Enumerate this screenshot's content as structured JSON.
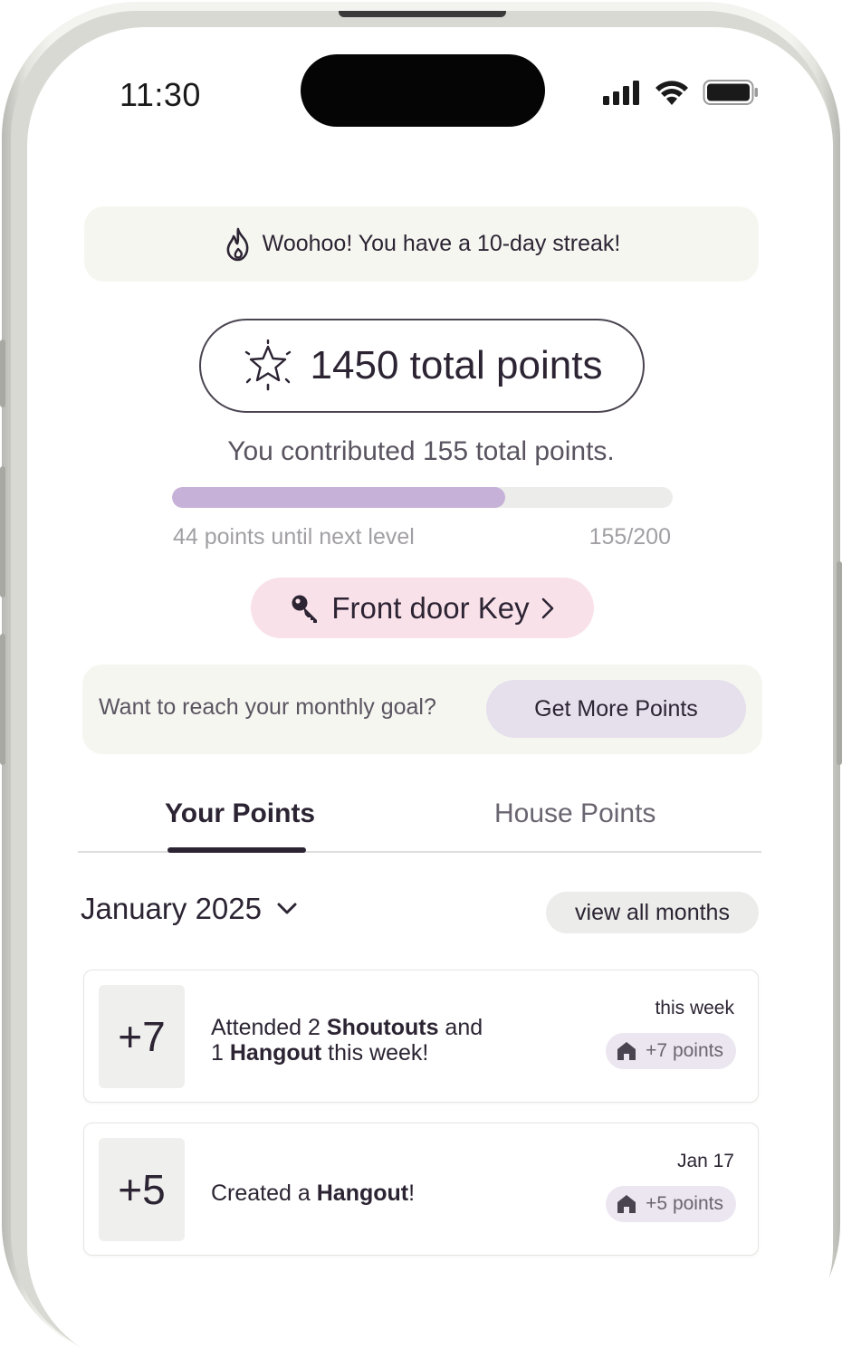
{
  "status_bar": {
    "time": "11:30"
  },
  "streak": {
    "icon": "flame-icon",
    "text": "Woohoo! You have a 10-day streak!"
  },
  "total_points": {
    "icon": "star-icon",
    "label": "1450 total points"
  },
  "contribution": {
    "text": "You contributed 155 total points.",
    "progress_fraction": 0.665,
    "until_next_level": "44 points until next level",
    "ratio": "155/200",
    "fill_color": "#c6b1d8"
  },
  "reward": {
    "icon": "key-icon",
    "label": "Front door Key"
  },
  "goal": {
    "text": "Want to reach your monthly goal?",
    "button": "Get More Points"
  },
  "tabs": [
    {
      "label": "Your Points",
      "active": true
    },
    {
      "label": "House Points",
      "active": false
    }
  ],
  "month_filter": {
    "selected": "January 2025",
    "view_all": "view all months"
  },
  "entries": [
    {
      "amount": "+7",
      "line1": [
        {
          "t": "Attended 2 ",
          "b": false
        },
        {
          "t": "Shoutouts",
          "b": true
        },
        {
          "t": " and",
          "b": false
        }
      ],
      "line2": [
        {
          "t": "1 ",
          "b": false
        },
        {
          "t": "Hangout",
          "b": true
        },
        {
          "t": " this week!",
          "b": false
        }
      ],
      "date": "this week",
      "chip": "+7 points"
    },
    {
      "amount": "+5",
      "line1": [
        {
          "t": "Created a ",
          "b": false
        },
        {
          "t": "Hangout",
          "b": true
        },
        {
          "t": "!",
          "b": false
        }
      ],
      "line2": [],
      "date": "Jan 17",
      "chip": "+5 points"
    }
  ]
}
